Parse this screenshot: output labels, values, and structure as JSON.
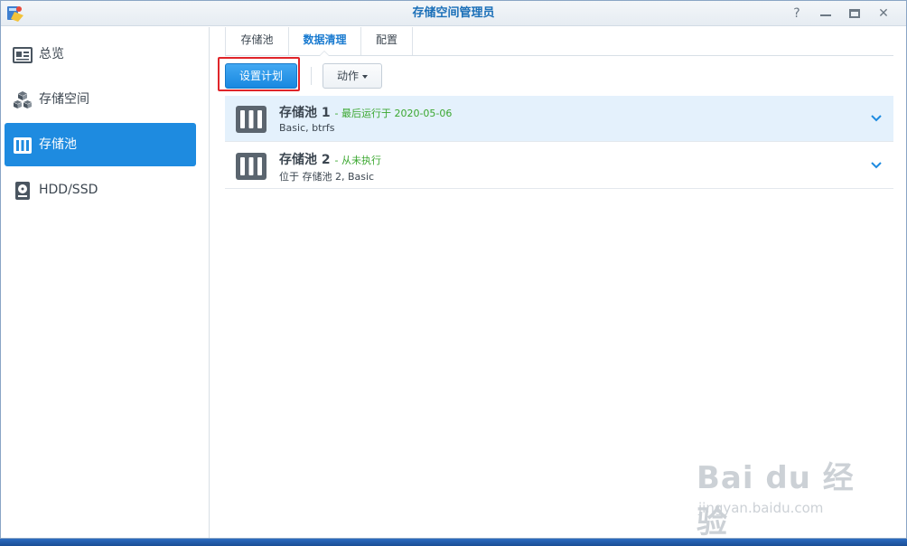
{
  "window": {
    "title": "存储空间管理员",
    "controls": {
      "help": "?",
      "close": "✕"
    }
  },
  "sidebar": {
    "items": [
      {
        "label": "总览",
        "icon": "overview-card-icon",
        "active": false
      },
      {
        "label": "存储空间",
        "icon": "cubes-icon",
        "active": false
      },
      {
        "label": "存储池",
        "icon": "storage-pool-icon",
        "active": true
      },
      {
        "label": "HDD/SSD",
        "icon": "hard-disk-icon",
        "active": false
      }
    ]
  },
  "tabs": [
    {
      "label": "存储池",
      "active": false
    },
    {
      "label": "数据清理",
      "active": true
    },
    {
      "label": "配置",
      "active": false
    }
  ],
  "toolbar": {
    "schedule_label": "设置计划",
    "action_label": "动作"
  },
  "pools": [
    {
      "name": "存储池 1",
      "status": "- 最后运行于 2020-05-06",
      "detail": "Basic, btrfs",
      "selected": true
    },
    {
      "name": "存储池 2",
      "status": "- 从未执行",
      "detail": "位于 存储池 2, Basic",
      "selected": false
    }
  ],
  "watermark": {
    "logo": "Bai du 经验",
    "url": "jingyan.baidu.com"
  },
  "colors": {
    "accent": "#1e8be0",
    "title": "#1a6fb8",
    "status_green": "#3aa72f",
    "highlight_red": "#e0252a",
    "selected_row": "#e4f1fc"
  }
}
